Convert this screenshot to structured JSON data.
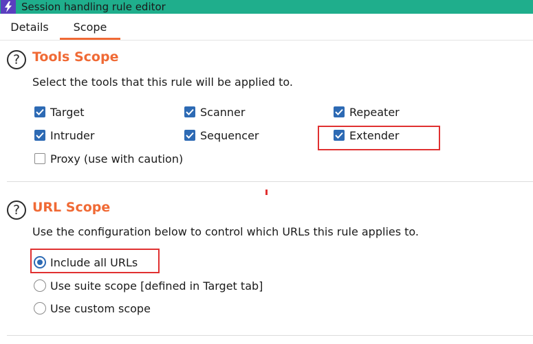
{
  "window": {
    "title": "Session handling rule editor",
    "app_icon": "lightning-bolt-icon"
  },
  "tabs": [
    {
      "label": "Details",
      "active": false
    },
    {
      "label": "Scope",
      "active": true
    }
  ],
  "colors": {
    "titlebar": "#1fae8c",
    "accent": "#f06a35",
    "checkbox": "#2d6ab4",
    "highlight": "#e03030"
  },
  "tools_scope": {
    "title": "Tools Scope",
    "description": "Select the tools that this rule will be applied to.",
    "tools": [
      {
        "label": "Target",
        "checked": true
      },
      {
        "label": "Scanner",
        "checked": true
      },
      {
        "label": "Repeater",
        "checked": true
      },
      {
        "label": "Intruder",
        "checked": true
      },
      {
        "label": "Sequencer",
        "checked": true
      },
      {
        "label": "Extender",
        "checked": true
      },
      {
        "label": "Proxy (use with caution)",
        "checked": false
      }
    ]
  },
  "url_scope": {
    "title": "URL Scope",
    "description": "Use the configuration below to control which URLs this rule applies to.",
    "options": [
      {
        "label": "Include all URLs",
        "selected": true
      },
      {
        "label": "Use suite scope [defined in Target tab]",
        "selected": false
      },
      {
        "label": "Use custom scope",
        "selected": false
      }
    ]
  }
}
